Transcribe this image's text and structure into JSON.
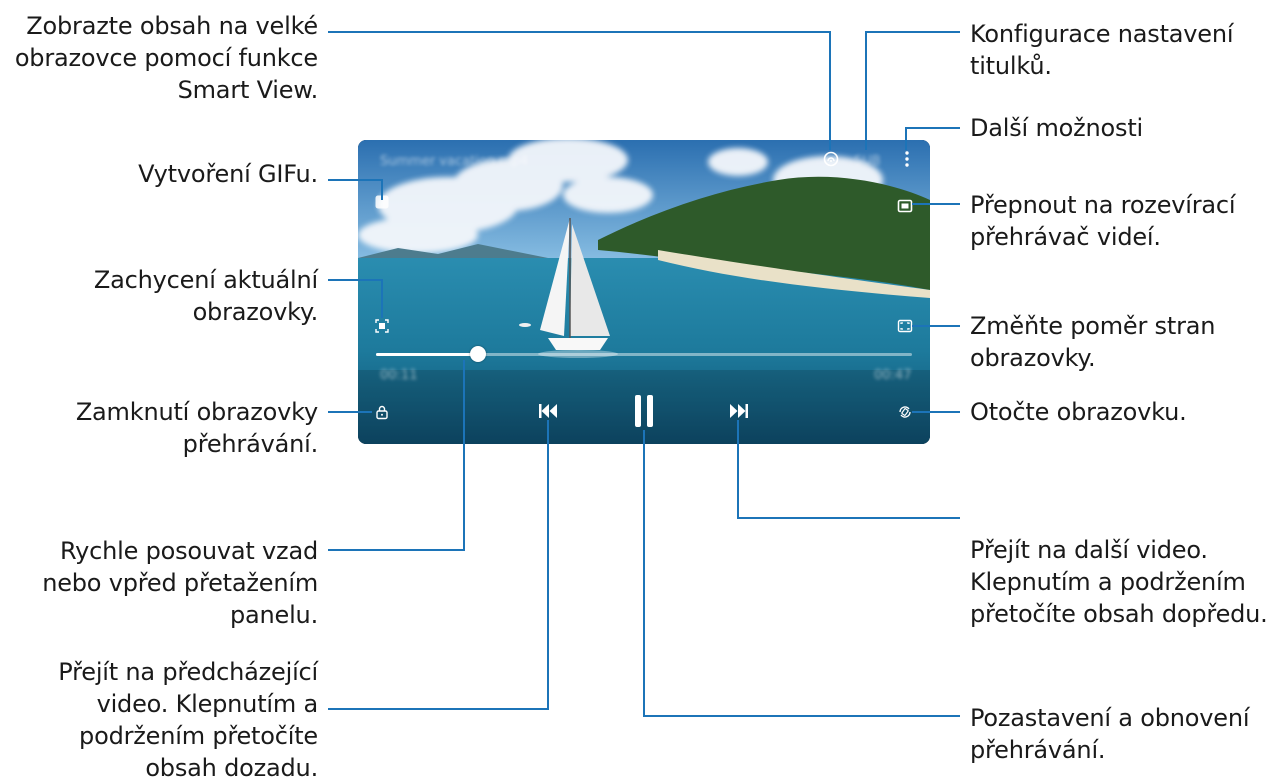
{
  "player": {
    "video_title": "Summer vacation mp4",
    "subtitle_label": "SUB",
    "elapsed": "00:11",
    "duration": "00:47",
    "progress": 0.19
  },
  "callouts": {
    "smart_view": "Zobrazte obsah na velké\nobrazovce pomocí funkce\nSmart View.",
    "subtitles": "Konfigurace nastavení\ntitulků.",
    "more_options": "Další možnosti",
    "gif": "Vytvoření GIFu.",
    "popup_player": "Přepnout na rozevírací\npřehrávač videí.",
    "capture": "Zachycení aktuální\nobrazovky.",
    "aspect_ratio": "Změňte poměr stran\nobrazovky.",
    "lock": "Zamknutí obrazovky\npřehrávání.",
    "rotate": "Otočte obrazovku.",
    "next": "Přejít na další video.\nKlepnutím a podržením\npřetočíte obsah dopředu.",
    "seek": "Rychle posouvat vzad\nnebo vpřed přetažením\npanelu.",
    "previous": "Přejít na předcházející\nvideo. Klepnutím a\npodržením přetočíte\nobsah dozadu.",
    "pause": "Pozastavení a obnovení\npřehrávání."
  },
  "icons": {
    "smart_view": "smart-view-icon",
    "more": "more-vertical-icon",
    "gif": "gif-icon",
    "popup": "popup-player-icon",
    "capture": "capture-icon",
    "ratio": "aspect-ratio-icon",
    "lock": "lock-icon",
    "rotate": "rotate-icon",
    "prev": "skip-previous-icon",
    "pause": "pause-icon",
    "next": "skip-next-icon"
  },
  "colors": {
    "leader_line": "#1c74b8",
    "text": "#1a1a1a",
    "sea": "#1f7fa0"
  }
}
